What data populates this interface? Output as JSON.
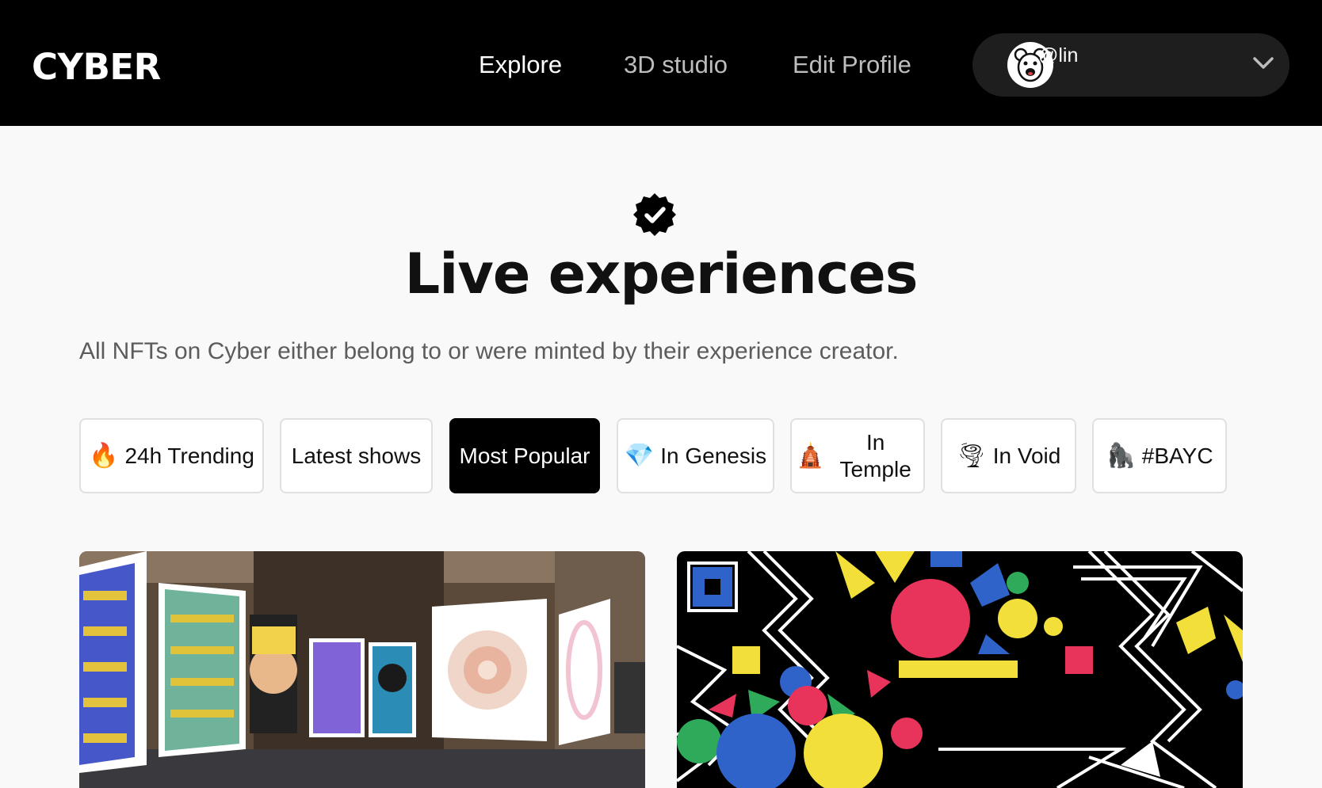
{
  "header": {
    "logo": "CYBER",
    "nav": [
      {
        "label": "Explore",
        "active": true
      },
      {
        "label": "3D studio",
        "active": false
      },
      {
        "label": "Edit Profile",
        "active": false
      }
    ],
    "user": {
      "handle": "@lin",
      "avatar_icon": "bear-avatar-icon"
    }
  },
  "hero": {
    "badge_icon": "verified-badge-icon",
    "title": "Live experiences",
    "subtitle": "All NFTs on Cyber either belong to or were minted by their experience creator."
  },
  "filters": [
    {
      "emoji": "🔥",
      "label": "24h Trending",
      "active": false
    },
    {
      "emoji": "",
      "label": "Latest shows",
      "active": false
    },
    {
      "emoji": "",
      "label": "Most Popular",
      "active": true
    },
    {
      "emoji": "💎",
      "label": "In Genesis",
      "active": false
    },
    {
      "emoji": "🛕",
      "label": "In Temple",
      "active": false
    },
    {
      "emoji": "🌪",
      "label": "In Void",
      "active": false
    },
    {
      "emoji": "🦍",
      "label": "#BAYC",
      "active": false
    }
  ],
  "cards": [
    {
      "name": "gallery-experience"
    },
    {
      "name": "geometric-experience"
    }
  ],
  "colors": {
    "header_bg": "#000000",
    "page_bg": "#f9f9f9",
    "active_filter_bg": "#000000",
    "pill_bg": "#1e1e1e"
  }
}
